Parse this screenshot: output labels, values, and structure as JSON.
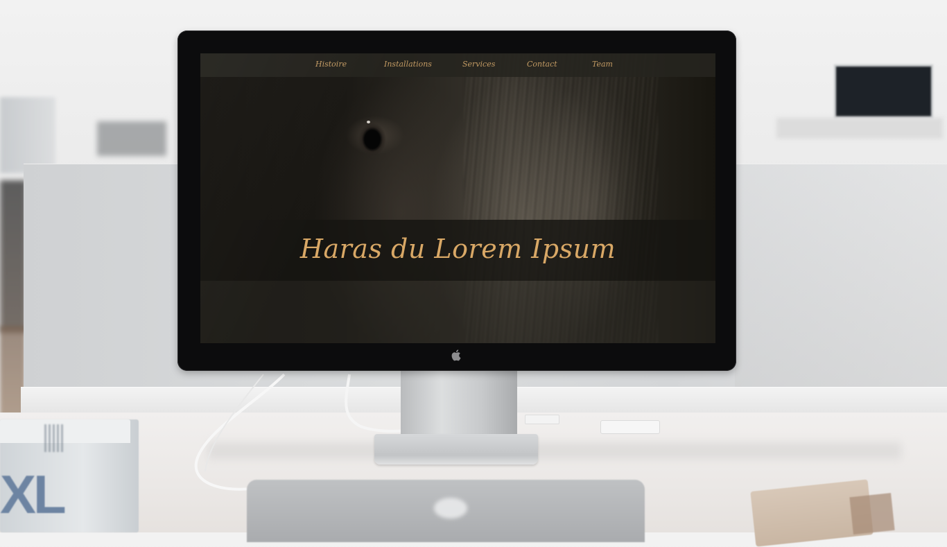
{
  "website": {
    "nav": {
      "items": [
        {
          "label": "Histoire"
        },
        {
          "label": "Installations"
        },
        {
          "label": "Services"
        },
        {
          "label": "Contact"
        },
        {
          "label": "Team"
        }
      ]
    },
    "hero": {
      "title": "Haras du Lorem Ipsum"
    }
  },
  "book": {
    "cover_text": "XL"
  },
  "colors": {
    "accent": "#d9a866",
    "nav_text": "#c29a63",
    "nav_bar": "#26241f",
    "hero_band": "#161511"
  },
  "icons": {
    "monitor_logo": "apple-logo-icon"
  }
}
